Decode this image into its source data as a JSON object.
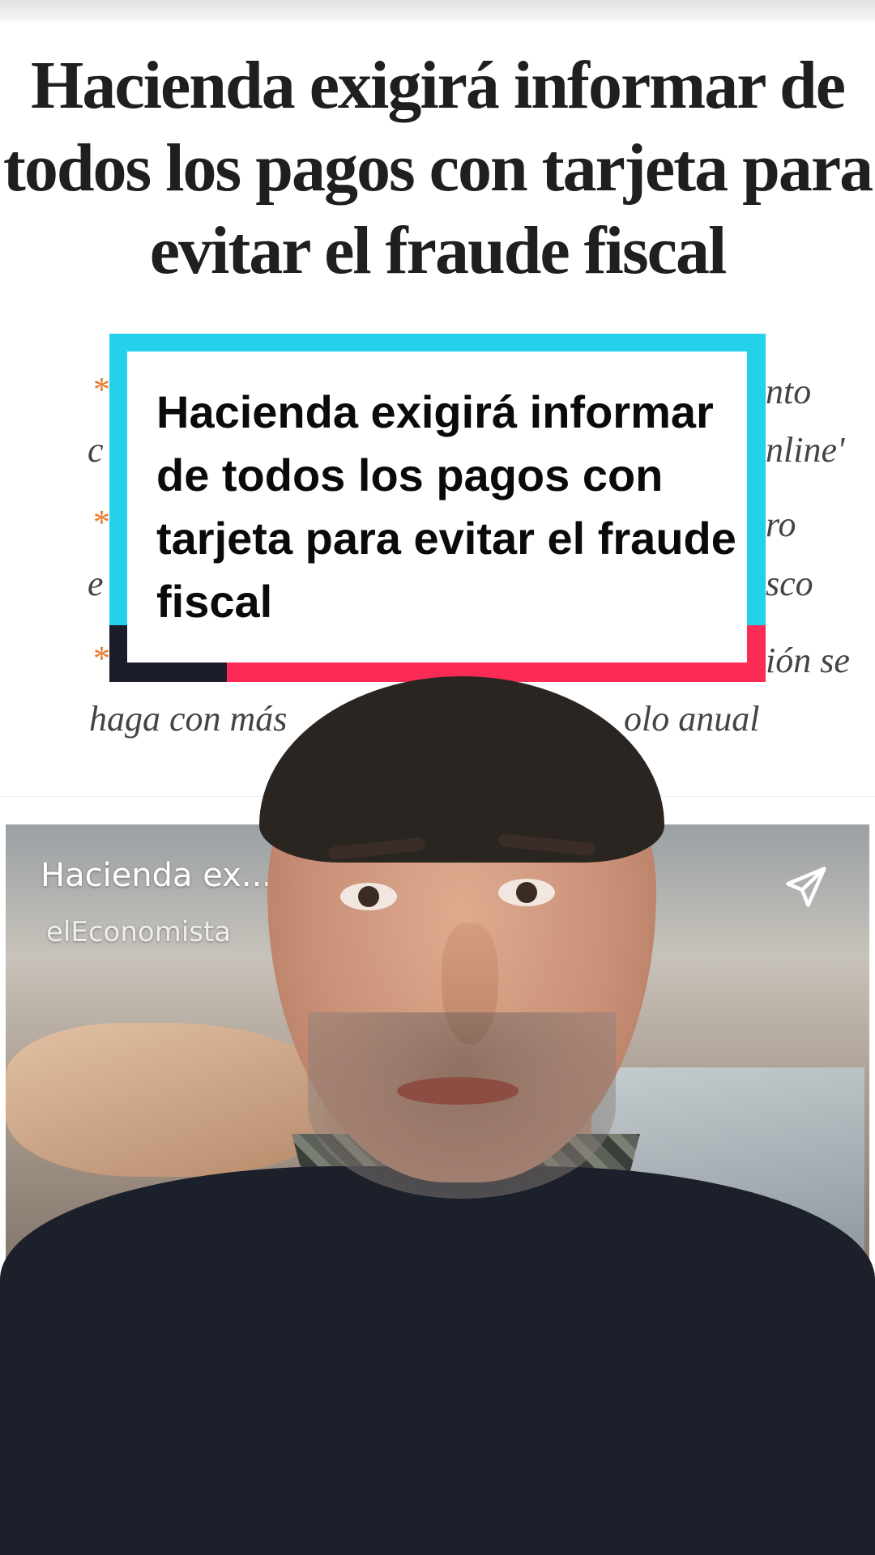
{
  "article": {
    "headline": "Hacienda exigirá informar de todos los pagos con tarjeta para evitar el fraude fiscal",
    "bullets_visible_fragments": [
      "nto",
      "c",
      "nline'",
      "ro",
      "e",
      "sco",
      "ión se",
      "haga con más",
      "olo anual"
    ],
    "bullet_marker": "*"
  },
  "caption_overlay": {
    "text": "Hacienda exigirá informar de todos los pagos con tarjeta para evitar el fraude fiscal"
  },
  "video_card": {
    "title": "Hacienda ex...",
    "source": "elEconomista",
    "share_icon": "send-icon"
  },
  "colors": {
    "accent_cyan": "#25d1ea",
    "accent_red": "#fb2b55",
    "accent_dark": "#1b1e2a",
    "bullet_orange": "#e8772c"
  }
}
